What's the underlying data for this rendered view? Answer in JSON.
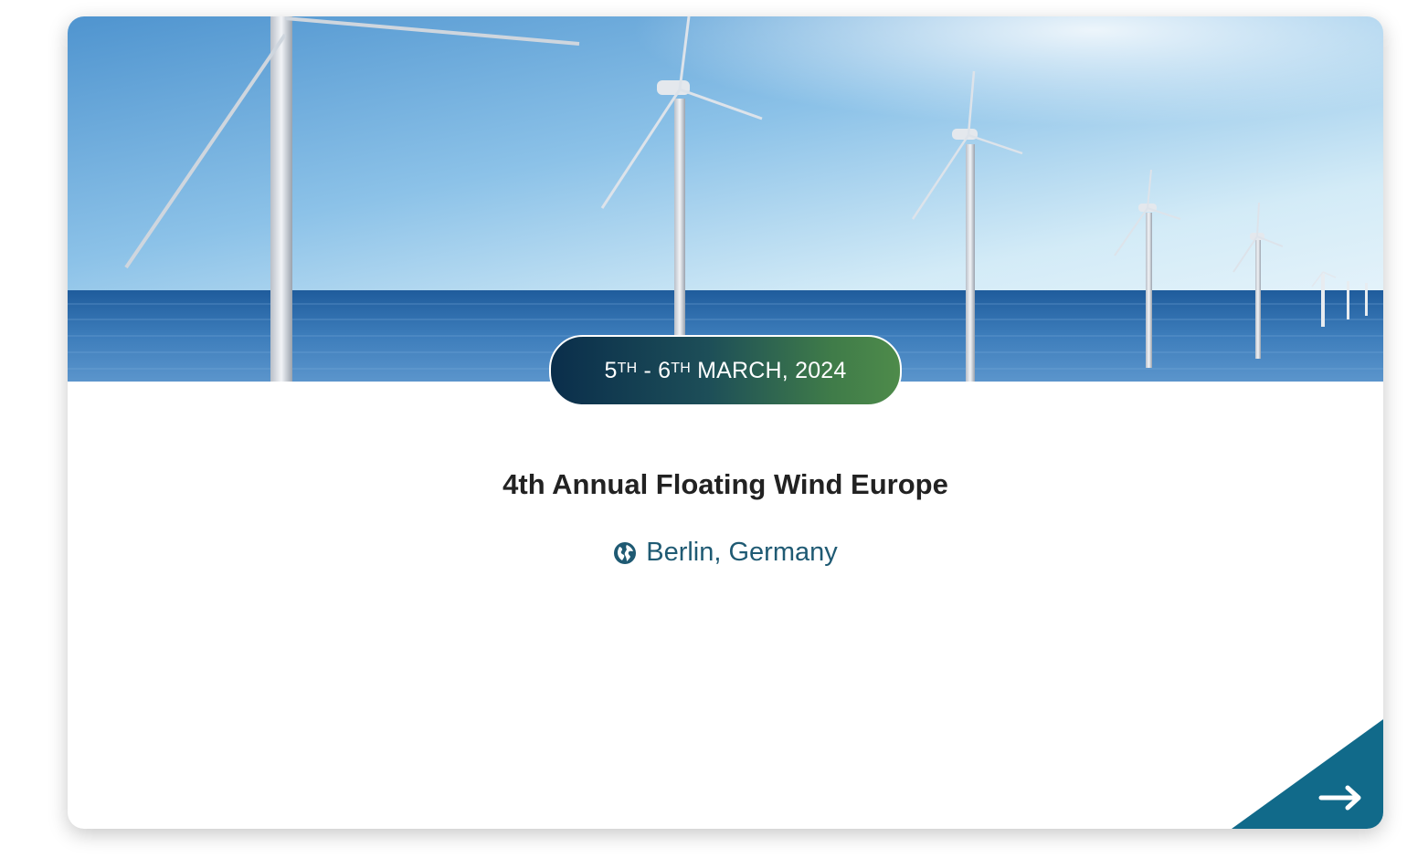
{
  "event": {
    "date": {
      "day1": "5",
      "day1_suffix": "TH",
      "separator": " - ",
      "day2": "6",
      "day2_suffix": "TH",
      "month_year": " MARCH, 2024"
    },
    "title": "4th Annual Floating Wind Europe",
    "location": "Berlin, Germany"
  },
  "colors": {
    "accent": "#1f5a73",
    "corner": "#116a8a",
    "pill_start": "#0a2e4b",
    "pill_end": "#4e8b4a"
  },
  "icons": {
    "location": "globe-icon",
    "link": "arrow-right-icon"
  }
}
